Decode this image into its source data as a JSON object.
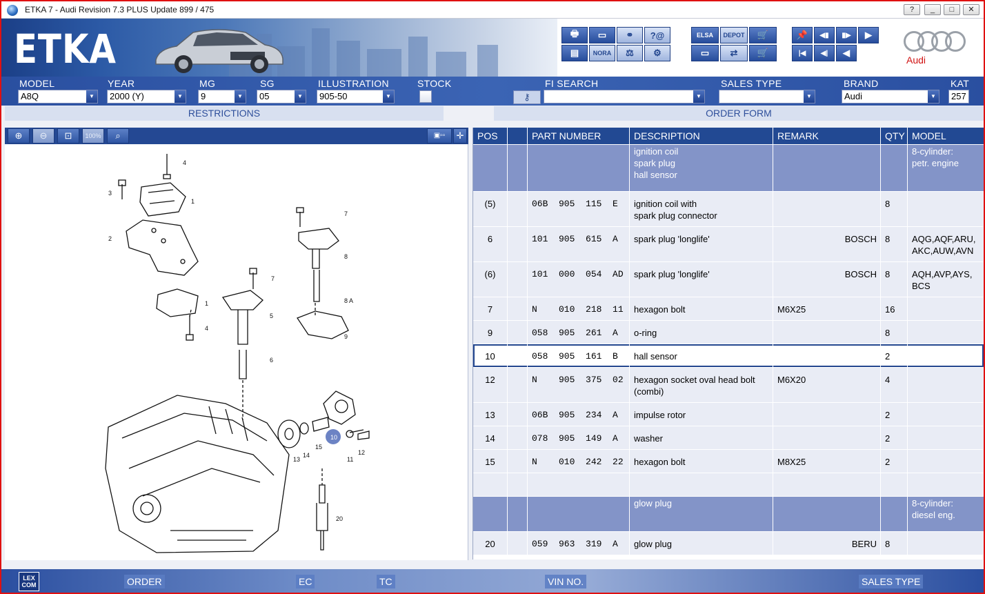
{
  "window": {
    "title": "ETKA 7 - Audi Revision 7.3 PLUS Update 899 / 475",
    "help": "?",
    "minimize": "_",
    "maximize": "□",
    "close": "✕"
  },
  "banner": {
    "logo_text": "ETKA",
    "brand_logo_text": "Audi"
  },
  "toolbar": {
    "group1": [
      "🖶",
      "▭",
      "⚭",
      "?@",
      "▤",
      "NORA",
      "⚖",
      "⚙"
    ],
    "group2": [
      "ELSA",
      "DEPOT",
      "🛒",
      "▭",
      "⇄",
      "🛒"
    ],
    "group3": [
      "📌",
      "◀▮",
      "▮▶",
      "▶",
      "|◀",
      "◀|",
      "◀"
    ]
  },
  "filters": {
    "model": {
      "label": "MODEL",
      "value": "A8Q"
    },
    "year": {
      "label": "YEAR",
      "value": "2000 (Y)"
    },
    "mg": {
      "label": "MG",
      "value": "9"
    },
    "sg": {
      "label": "SG",
      "value": "05"
    },
    "illustration": {
      "label": "ILLUSTRATION",
      "value": "905-50"
    },
    "stock": {
      "label": "STOCK"
    },
    "fi_search": {
      "label": "FI SEARCH",
      "value": ""
    },
    "sales_type": {
      "label": "SALES TYPE",
      "value": ""
    },
    "brand": {
      "label": "BRAND",
      "value": "Audi"
    },
    "kat": {
      "label": "KAT",
      "value": "257"
    }
  },
  "sections": {
    "restrictions": "RESTRICTIONS",
    "order_form": "ORDER FORM"
  },
  "drawing_toolbar": [
    "⊕",
    "⊖",
    "⊡",
    "100%",
    "⌕",
    "▣▫▫",
    "✛"
  ],
  "drawing_labels": [
    "4",
    "3",
    "1",
    "2",
    "1",
    "4",
    "7",
    "7",
    "8",
    "8 A",
    "5",
    "9",
    "6",
    "10",
    "15",
    "14",
    "13",
    "11",
    "12",
    "20"
  ],
  "table": {
    "headers": [
      "POS",
      "",
      "PART NUMBER",
      "DESCRIPTION",
      "REMARK",
      "QTY",
      "MODEL"
    ],
    "rows": [
      {
        "type": "grp",
        "pos": "",
        "part": "",
        "desc": "ignition coil\nspark plug\nhall sensor",
        "remark": "",
        "remark_right": "",
        "qty": "",
        "model": "8-cylinder:\npetr. engine"
      },
      {
        "type": "norm",
        "pos": "(5)",
        "part": "06B  905  115  E",
        "desc": "ignition coil with\nspark plug connector",
        "remark": "",
        "remark_right": "",
        "qty": "8",
        "model": ""
      },
      {
        "type": "norm",
        "pos": "6",
        "part": "101  905  615  A",
        "desc": "spark plug 'longlife'",
        "remark": "",
        "remark_right": "BOSCH",
        "qty": "8",
        "model": "AQG,AQF,ARU,\nAKC,AUW,AVN"
      },
      {
        "type": "norm",
        "pos": "(6)",
        "part": "101  000  054  AD",
        "desc": "spark plug 'longlife'",
        "remark": "",
        "remark_right": "BOSCH",
        "qty": "8",
        "model": "AQH,AVP,AYS,\nBCS"
      },
      {
        "type": "norm",
        "pos": "7",
        "part": "N    010  218  11",
        "desc": "hexagon bolt",
        "remark": "M6X25",
        "remark_right": "",
        "qty": "16",
        "model": ""
      },
      {
        "type": "norm",
        "pos": "9",
        "part": "058  905  261  A",
        "desc": "o-ring",
        "remark": "",
        "remark_right": "",
        "qty": "8",
        "model": ""
      },
      {
        "type": "sel",
        "pos": "10",
        "part": "058  905  161  B",
        "desc": "hall sensor",
        "remark": "",
        "remark_right": "",
        "qty": "2",
        "model": ""
      },
      {
        "type": "norm",
        "pos": "12",
        "part": "N    905  375  02",
        "desc": "hexagon socket oval head bolt\n(combi)",
        "remark": "M6X20",
        "remark_right": "",
        "qty": "4",
        "model": ""
      },
      {
        "type": "norm",
        "pos": "13",
        "part": "06B  905  234  A",
        "desc": "impulse rotor",
        "remark": "",
        "remark_right": "",
        "qty": "2",
        "model": ""
      },
      {
        "type": "norm",
        "pos": "14",
        "part": "078  905  149  A",
        "desc": "washer",
        "remark": "",
        "remark_right": "",
        "qty": "2",
        "model": ""
      },
      {
        "type": "norm",
        "pos": "15",
        "part": "N    010  242  22",
        "desc": "hexagon bolt",
        "remark": "M8X25",
        "remark_right": "",
        "qty": "2",
        "model": ""
      },
      {
        "type": "blank",
        "pos": "",
        "part": "",
        "desc": "",
        "remark": "",
        "remark_right": "",
        "qty": "",
        "model": ""
      },
      {
        "type": "grp",
        "pos": "",
        "part": "",
        "desc": "glow plug",
        "remark": "",
        "remark_right": "",
        "qty": "",
        "model": "8-cylinder:\ndiesel eng."
      },
      {
        "type": "norm",
        "pos": "20",
        "part": "059  963  319  A",
        "desc": "glow plug",
        "remark": "",
        "remark_right": "BERU",
        "qty": "8",
        "model": ""
      }
    ]
  },
  "bottom": {
    "lexcom": "LEX\nCOM",
    "order": "ORDER",
    "ec": "EC",
    "tc": "TC",
    "vin": "VIN NO.",
    "sales_type": "SALES TYPE"
  }
}
